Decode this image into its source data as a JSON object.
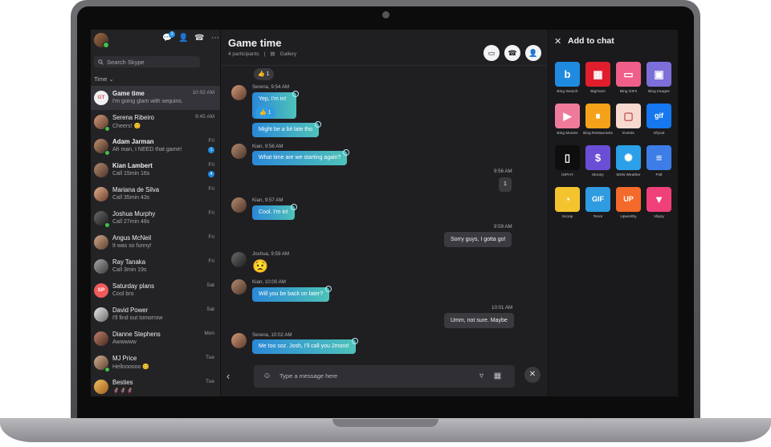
{
  "sidebar": {
    "search_placeholder": "Search Skype",
    "sort_label": "Time",
    "chats_badge": "3",
    "items": [
      {
        "name": "Game time",
        "preview": "I'm going glam with sequins.",
        "time": "10:02 AM",
        "initials": "GT",
        "bold": true
      },
      {
        "name": "Serena Ribeiro",
        "preview": "Cheers! 😊",
        "time": "9:45 AM"
      },
      {
        "name": "Adam Jarman",
        "preview": "Ah man, I NEED that game!",
        "time": "Fri",
        "badge": "1",
        "bold": true
      },
      {
        "name": "Kian Lambert",
        "preview": "Call 15min 16s",
        "time": "Fri",
        "badge": "4",
        "bold": true
      },
      {
        "name": "Mariana de Silva",
        "preview": "Call 35min 43s",
        "time": "Fri"
      },
      {
        "name": "Joshua Murphy",
        "preview": "Call 27min 48s",
        "time": "Fri"
      },
      {
        "name": "Angus McNeil",
        "preview": "It was so funny!",
        "time": "Fri"
      },
      {
        "name": "Ray Tanaka",
        "preview": "Call 3min 19s",
        "time": "Fri"
      },
      {
        "name": "Saturday plans",
        "preview": "Cool bro",
        "time": "Sat",
        "initials": "SP"
      },
      {
        "name": "David Power",
        "preview": "I'll find out tomorrow",
        "time": "Sat"
      },
      {
        "name": "Dianne Stephens",
        "preview": "Awwwww",
        "time": "Mon"
      },
      {
        "name": "MJ Price",
        "preview": "Helloooooo 😊",
        "time": "Tue"
      },
      {
        "name": "Besties",
        "preview": "🦸🦸🦸",
        "time": "Tue"
      }
    ]
  },
  "chat": {
    "title": "Game time",
    "participants": "4 participants",
    "separator": "|",
    "gallery": "Gallery",
    "composer_placeholder": "Type a message here",
    "messages": [
      {
        "react": "👍 1"
      },
      {
        "meta": "Serena, 9:54 AM",
        "text": "Yep, I'm in!",
        "react": "👍 1"
      },
      {
        "text": "Might be a bit late tho"
      },
      {
        "meta": "Kian, 9:56 AM",
        "text": "What time are we starting again?"
      },
      {
        "out_time": "9:56 AM",
        "text": "1"
      },
      {
        "meta": "Kian, 9:57 AM",
        "text": "Cool. I'm in!"
      },
      {
        "out_time": "9:59 AM",
        "text": "Sorry guys, I gotta go!"
      },
      {
        "meta": "Joshua, 9:59 AM",
        "emoji": "😟"
      },
      {
        "meta": "Kian, 10:00 AM",
        "text": "Will you be back on later?"
      },
      {
        "out_time": "10:01 AM",
        "text": "Umm, not sure. Maybe"
      },
      {
        "meta": "Serena, 10:02 AM",
        "text": "Me too soz. Josh, I'll call you 2moro!"
      }
    ]
  },
  "panel": {
    "title": "Add to chat",
    "apps": [
      {
        "label": "Bing Search",
        "color": "#1f8be0",
        "glyph": "b"
      },
      {
        "label": "BigOven",
        "color": "#e01e2d",
        "glyph": "▦"
      },
      {
        "label": "Bing GIFs",
        "color": "#f05f8a",
        "glyph": "▭"
      },
      {
        "label": "Bing Images",
        "color": "#7c6fd9",
        "glyph": "▣"
      },
      {
        "label": "Bing Movies",
        "color": "#f07a9a",
        "glyph": "▶"
      },
      {
        "label": "Bing Restaurants",
        "color": "#f3a21a",
        "glyph": "⏸"
      },
      {
        "label": "Events",
        "color": "#f7d9d0",
        "glyph": "▢"
      },
      {
        "label": "Gfycat",
        "color": "#1677ee",
        "glyph": "gif"
      },
      {
        "label": "GIPHY",
        "color": "#0e0e0e",
        "glyph": "▯"
      },
      {
        "label": "Money",
        "color": "#6a4fd6",
        "glyph": "$"
      },
      {
        "label": "MSN Weather",
        "color": "#2ba0e8",
        "glyph": "✺"
      },
      {
        "label": "Poll",
        "color": "#3d7de8",
        "glyph": "≡"
      },
      {
        "label": "Scoop",
        "color": "#f3c42e",
        "glyph": "◔"
      },
      {
        "label": "Tenor",
        "color": "#2f9be0",
        "glyph": "GIF"
      },
      {
        "label": "Upworthy",
        "color": "#f36a2a",
        "glyph": "UP"
      },
      {
        "label": "Vlipsy",
        "color": "#f0407a",
        "glyph": "▼"
      }
    ]
  }
}
